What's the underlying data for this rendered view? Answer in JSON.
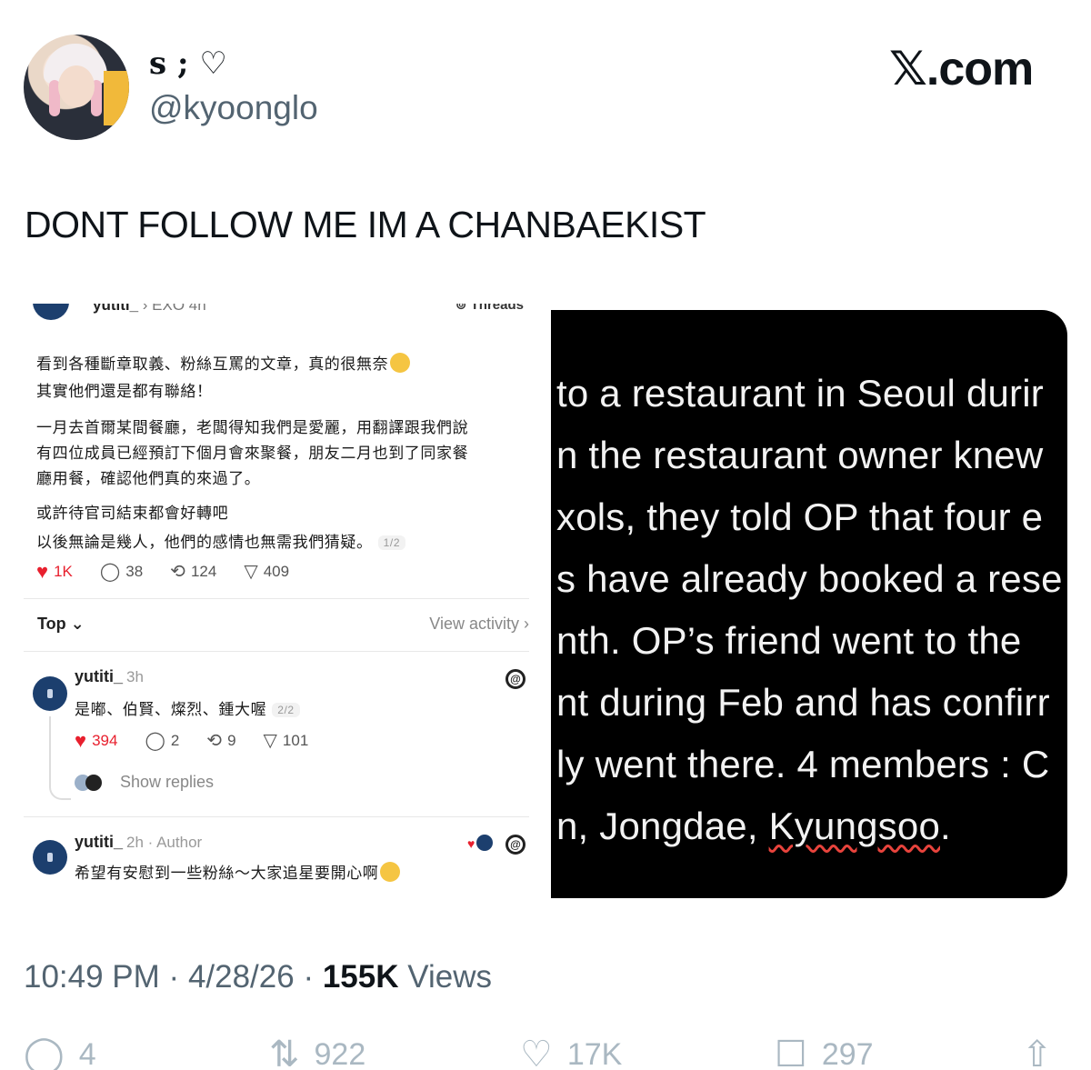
{
  "user": {
    "display_name": "s ; ♡",
    "handle": "@kyoonglo"
  },
  "brand": {
    "logo_text": "𝕏.com"
  },
  "tweet": {
    "text": "DONT FOLLOW ME IM A CHANBAEKIST",
    "time": "10:49 PM",
    "date": "4/28/26",
    "views_count": "155K",
    "views_label": "Views",
    "sep": "·"
  },
  "threads_post": {
    "username": "yutiti_",
    "community": "› EXO 4h",
    "app_label": "⊚ Threads",
    "lines": [
      "看到各種斷章取義、粉絲互罵的文章，真的很無奈",
      "其實他們還是都有聯絡！",
      "一月去首爾某間餐廳，老闆得知我們是愛麗，用翻譯跟我們說",
      "有四位成員已經預訂下個月會來聚餐，朋友二月也到了同家餐",
      "廳用餐，確認他們真的來過了。",
      "或許待官司結束都會好轉吧",
      "以後無論是幾人，他們的感情也無需我們猜疑。"
    ],
    "pager": "1/2",
    "likes": "1K",
    "comments": "38",
    "reposts": "124",
    "shares": "409",
    "sort_label": "Top ⌄",
    "view_activity": "View activity ›",
    "reply1": {
      "username": "yutiti_",
      "meta": "3h",
      "text": "是嘟、伯賢、燦烈、鍾大喔",
      "pager": "2/2",
      "likes": "394",
      "comments": "2",
      "reposts": "9",
      "shares": "101",
      "show_replies": "Show replies"
    },
    "reply2": {
      "username": "yutiti_",
      "meta": "2h · Author",
      "text": "希望有安慰到一些粉絲～大家追星要開心啊"
    }
  },
  "translation_lines": [
    "to a restaurant in Seoul durir",
    "n the restaurant owner knew",
    "xols, they told OP that four e",
    "s have already booked a rese",
    "nth. OP’s friend went to the",
    "nt during Feb and has confirr",
    "ly went there. 4 members : C",
    "n, Jongdae, "
  ],
  "translation_misspelled": "Kyungsoo",
  "translation_end": ".",
  "actions": {
    "replies": "4",
    "reposts": "922",
    "likes": "17K",
    "bookmarks": "297"
  },
  "icons": {
    "reply": "reply-icon",
    "repost": "repost-icon",
    "like": "heart-icon",
    "bookmark": "bookmark-icon",
    "share": "share-icon"
  }
}
